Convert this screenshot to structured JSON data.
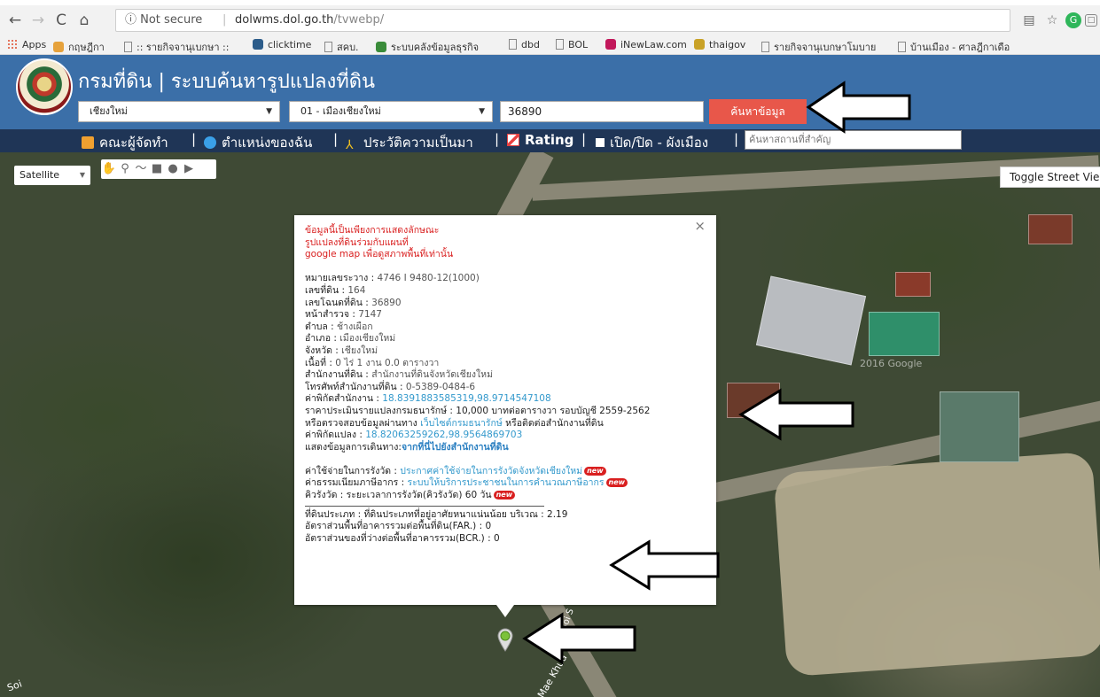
{
  "browser": {
    "nav": {
      "back": "←",
      "forward": "→",
      "reload": "C",
      "home": "⌂"
    },
    "security_label": "ⓘ Not secure",
    "url_host": "dolwms.dol.go.th",
    "url_path": "/tvwebp/",
    "bookmarks": [
      {
        "label": "Apps",
        "icon": "apps-icon",
        "color": "#e04a2a"
      },
      {
        "label": "กฤษฎีกา",
        "icon": "lotus-icon",
        "color": "#e6a23c"
      },
      {
        "label": ":: รายกิจจานุเบกษา ::",
        "icon": "page-icon",
        "color": "#888888"
      },
      {
        "label": "clicktime",
        "icon": "clicktime-icon",
        "color": "#2c5c8a"
      },
      {
        "label": "สคบ.",
        "icon": "page-icon",
        "color": "#888888"
      },
      {
        "label": "ระบบคลังข้อมูลธุรกิจ",
        "icon": "chart-icon",
        "color": "#3a8c3a"
      },
      {
        "label": "dbd",
        "icon": "page-icon",
        "color": "#888888"
      },
      {
        "label": "BOL",
        "icon": "page-icon",
        "color": "#888888"
      },
      {
        "label": "iNewLaw.com",
        "icon": "slash-icon",
        "color": "#c2185b"
      },
      {
        "label": "thaigov",
        "icon": "coin-icon",
        "color": "#c9a227"
      },
      {
        "label": "รายกิจจานุเบกษาโมบาย",
        "icon": "page-icon",
        "color": "#888888"
      },
      {
        "label": "บ้านเมือง - ศาลฎีกาเดือ",
        "icon": "page-icon",
        "color": "#888888"
      }
    ]
  },
  "header": {
    "title": "กรมที่ดิน | ระบบค้นหารูปแปลงที่ดิน",
    "province_select": "เชียงใหม่",
    "district_select": "01 - เมืองเชียงใหม่",
    "parcel_value": "36890",
    "search_button": "ค้นหาข้อมูล"
  },
  "menubar": {
    "items": [
      {
        "label": "คณะผู้จัดทำ",
        "icon": "team-icon",
        "color": "#f0a030"
      },
      {
        "label": "ตำแหน่งของฉัน",
        "icon": "globe-icon",
        "color": "#3aa0e8"
      },
      {
        "label": "ประวัติความเป็นมา",
        "icon": "history-icon",
        "color": "#f0c020"
      },
      {
        "label": "Rating",
        "icon": "rating-chart-icon",
        "color": "#e84040"
      },
      {
        "label": "เปิด/ปิด - ผังเมือง",
        "icon": "square-icon",
        "color": "#ffffff"
      }
    ],
    "place_placeholder": "ค้นหาสถานที่สำคัญ"
  },
  "map": {
    "maptype": "Satellite",
    "toggle_street_view": "Toggle Street Vie",
    "watermark": "2016 Google",
    "road_label_1": "Soi",
    "road_label_2": "Mae Khua",
    "road_label_3": "Soi S"
  },
  "info": {
    "disclaimer": [
      "ข้อมูลนี้เป็นเพียงการแสดงลักษณะ",
      "รูปแปลงที่ดินร่วมกับแผนที่",
      "google map เพื่อดูสภาพพื้นที่เท่านั้น"
    ],
    "rows": [
      {
        "label": "หมายเลขระวาง :",
        "value": "4746 I 9480-12(1000)"
      },
      {
        "label": "เลขที่ดิน :",
        "value": "164"
      },
      {
        "label": "เลขโฉนดที่ดิน :",
        "value": "36890"
      },
      {
        "label": "หน้าสำรวจ :",
        "value": "7147"
      },
      {
        "label": "ตำบล :",
        "value": "ช้างเผือก"
      },
      {
        "label": "อำเภอ :",
        "value": "เมืองเชียงใหม่"
      },
      {
        "label": "จังหวัด :",
        "value": "เชียงใหม่"
      },
      {
        "label": "เนื้อที่ :",
        "value": "0 ไร่ 1 งาน 0.0 ตารางวา"
      },
      {
        "label": "สำนักงานที่ดิน :",
        "value": "สำนักงานที่ดินจังหวัดเชียงใหม่"
      },
      {
        "label": "โทรศัพท์สำนักงานที่ดิน :",
        "value": "0-5389-0484-6"
      }
    ],
    "office_coord_label": "ค่าพิกัดสำนักงาน :",
    "office_coord": "18.8391883585319,98.9714547108",
    "price_line": "ราคาประเมินรายแปลงกรมธนารักษ์ : 10,000 บาทต่อตารางวา รอบบัญชี 2559-2562",
    "verify_prefix": "หรือตรวจสอบข้อมูลผ่านทาง",
    "verify_link": "เว็บไซต์กรมธนารักษ์",
    "verify_suffix": "หรือติดต่อสำนักงานที่ดิน",
    "parcel_coord_label": "ค่าพิกัดแปลง :",
    "parcel_coord": "18.82063259262,98.9564869703",
    "travel_label": "แสดงข้อมูลการเดินทาง:",
    "travel_link": "จากที่นี่ไปยังสำนักงานที่ดิน",
    "fee_label": "ค่าใช้จ่ายในการรังวัด :",
    "fee_link": "ประกาศค่าใช้จ่ายในการรังวัดจังหวัดเชียงใหม่",
    "tax_label": "ค่าธรรมเนียมภาษีอากร :",
    "tax_link": "ระบบให้บริการประชาชนในการคำนวณภาษีอากร",
    "queue_line": "คิวรังวัด : ระยะเวลาการรังวัด(คิวรังวัด) 60 วัน",
    "new_badge": "new",
    "landtype_line": "ที่ดินประเภท : ที่ดินประเภทที่อยู่อาศัยหนาแน่นน้อย บริเวณ : 2.19",
    "far_line": "อัตราส่วนพื้นที่อาคารรวมต่อพื้นที่ดิน(FAR.) : 0",
    "bcr_line": "อัตราส่วนของที่ว่างต่อพื้นที่อาคารรวม(BCR.) : 0",
    "close": "×"
  },
  "colors": {
    "header_bg": "#3b6fa8",
    "menubar_bg": "#1f3556",
    "search_button": "#e8574a",
    "disclaimer_red": "#d91f1f",
    "link_blue": "#3399cc"
  }
}
